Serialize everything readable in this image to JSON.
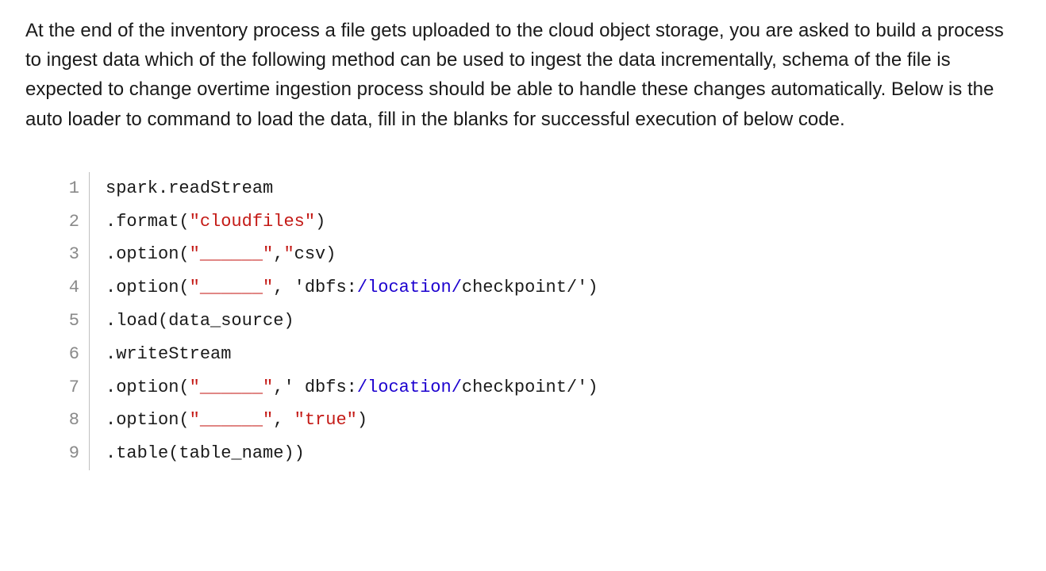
{
  "question": {
    "text": "At the end of the inventory process a file gets uploaded to the cloud object storage, you are asked to build a process to ingest data which of the following method can be used to ingest the data incrementally, schema of the file is expected to change overtime ingestion process should be able to handle these changes automatically. Below is the auto loader to command to load the data, fill in the blanks for successful execution of below code."
  },
  "code": {
    "lines": [
      {
        "num": "1",
        "tokens": [
          {
            "t": "spark.readStream",
            "c": "tok-default"
          }
        ]
      },
      {
        "num": "2",
        "tokens": [
          {
            "t": ".format(",
            "c": "tok-default"
          },
          {
            "t": "\"cloudfiles\"",
            "c": "tok-string"
          },
          {
            "t": ")",
            "c": "tok-default"
          }
        ]
      },
      {
        "num": "3",
        "tokens": [
          {
            "t": ".option(",
            "c": "tok-default"
          },
          {
            "t": "\"______\"",
            "c": "tok-string"
          },
          {
            "t": ",",
            "c": "tok-default"
          },
          {
            "t": "\"",
            "c": "tok-string"
          },
          {
            "t": "csv)",
            "c": "tok-default"
          }
        ]
      },
      {
        "num": "4",
        "tokens": [
          {
            "t": ".option(",
            "c": "tok-default"
          },
          {
            "t": "\"______\"",
            "c": "tok-string"
          },
          {
            "t": ", 'dbfs:",
            "c": "tok-default"
          },
          {
            "t": "/location/",
            "c": "tok-path"
          },
          {
            "t": "checkpoint/')",
            "c": "tok-default"
          }
        ]
      },
      {
        "num": "5",
        "tokens": [
          {
            "t": ".load(data_source)",
            "c": "tok-default"
          }
        ]
      },
      {
        "num": "6",
        "tokens": [
          {
            "t": ".writeStream",
            "c": "tok-default"
          }
        ]
      },
      {
        "num": "7",
        "tokens": [
          {
            "t": ".option(",
            "c": "tok-default"
          },
          {
            "t": "\"______\"",
            "c": "tok-string"
          },
          {
            "t": ",' dbfs:",
            "c": "tok-default"
          },
          {
            "t": "/location/",
            "c": "tok-path"
          },
          {
            "t": "checkpoint/')",
            "c": "tok-default"
          }
        ]
      },
      {
        "num": "8",
        "tokens": [
          {
            "t": ".option(",
            "c": "tok-default"
          },
          {
            "t": "\"______\"",
            "c": "tok-string"
          },
          {
            "t": ", ",
            "c": "tok-default"
          },
          {
            "t": "\"true\"",
            "c": "tok-string"
          },
          {
            "t": ")",
            "c": "tok-default"
          }
        ]
      },
      {
        "num": "9",
        "tokens": [
          {
            "t": ".table(table_name))",
            "c": "tok-default"
          }
        ]
      }
    ]
  }
}
